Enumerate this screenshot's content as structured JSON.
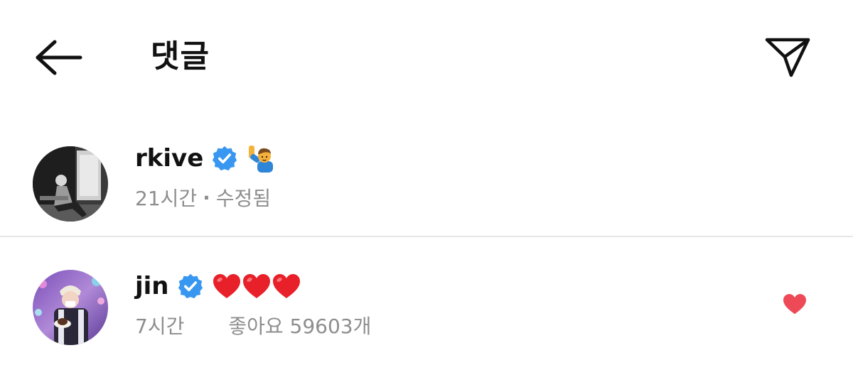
{
  "header": {
    "title": "댓글",
    "back_icon": "arrow-left-icon",
    "share_icon": "paper-plane-icon"
  },
  "comments": [
    {
      "username": "rkive",
      "verified": true,
      "text_emoji": "🙋‍♂️",
      "time": "21시간",
      "separator": "·",
      "edited": "수정됨",
      "liked": false
    },
    {
      "username": "jin",
      "verified": true,
      "text_emoji": "❤️❤️❤️",
      "time": "7시간",
      "likes": "좋아요 59603개",
      "liked": true
    }
  ],
  "colors": {
    "verified_blue": "#3897f0",
    "heart_red": "#ed4956",
    "meta_gray": "#8e8e8e",
    "emoji_red": "#e8202a"
  }
}
